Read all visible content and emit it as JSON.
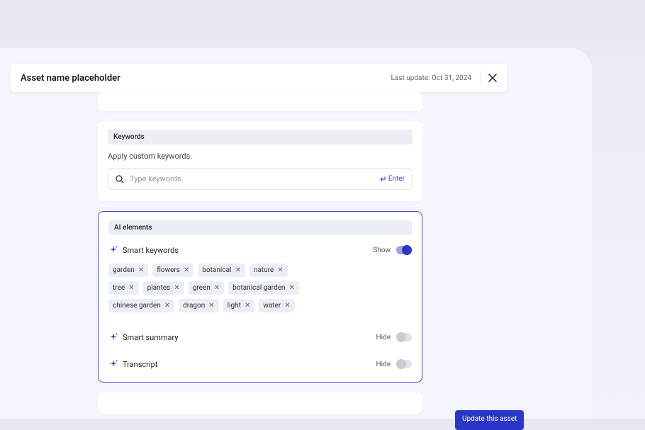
{
  "header": {
    "title": "Asset name placeholder",
    "last_update": "Last update: Oct 31, 2024"
  },
  "keywords_section": {
    "label": "Keywords",
    "description": "Apply custom keywords.",
    "input_placeholder": "Type keywords",
    "enter_hint": "Enter"
  },
  "ai_section": {
    "label": "AI elements",
    "rows": {
      "smart_keywords": {
        "title": "Smart keywords",
        "state_label": "Show"
      },
      "smart_summary": {
        "title": "Smart summary",
        "state_label": "Hide"
      },
      "transcript": {
        "title": "Transcript",
        "state_label": "Hide"
      }
    },
    "chips": [
      "garden",
      "flowers",
      "botanical",
      "nature",
      "tree",
      "plantes",
      "green",
      "botanical garden",
      "chinese garden",
      "dragon",
      "light",
      "water"
    ]
  },
  "update_button": "Update this asset"
}
